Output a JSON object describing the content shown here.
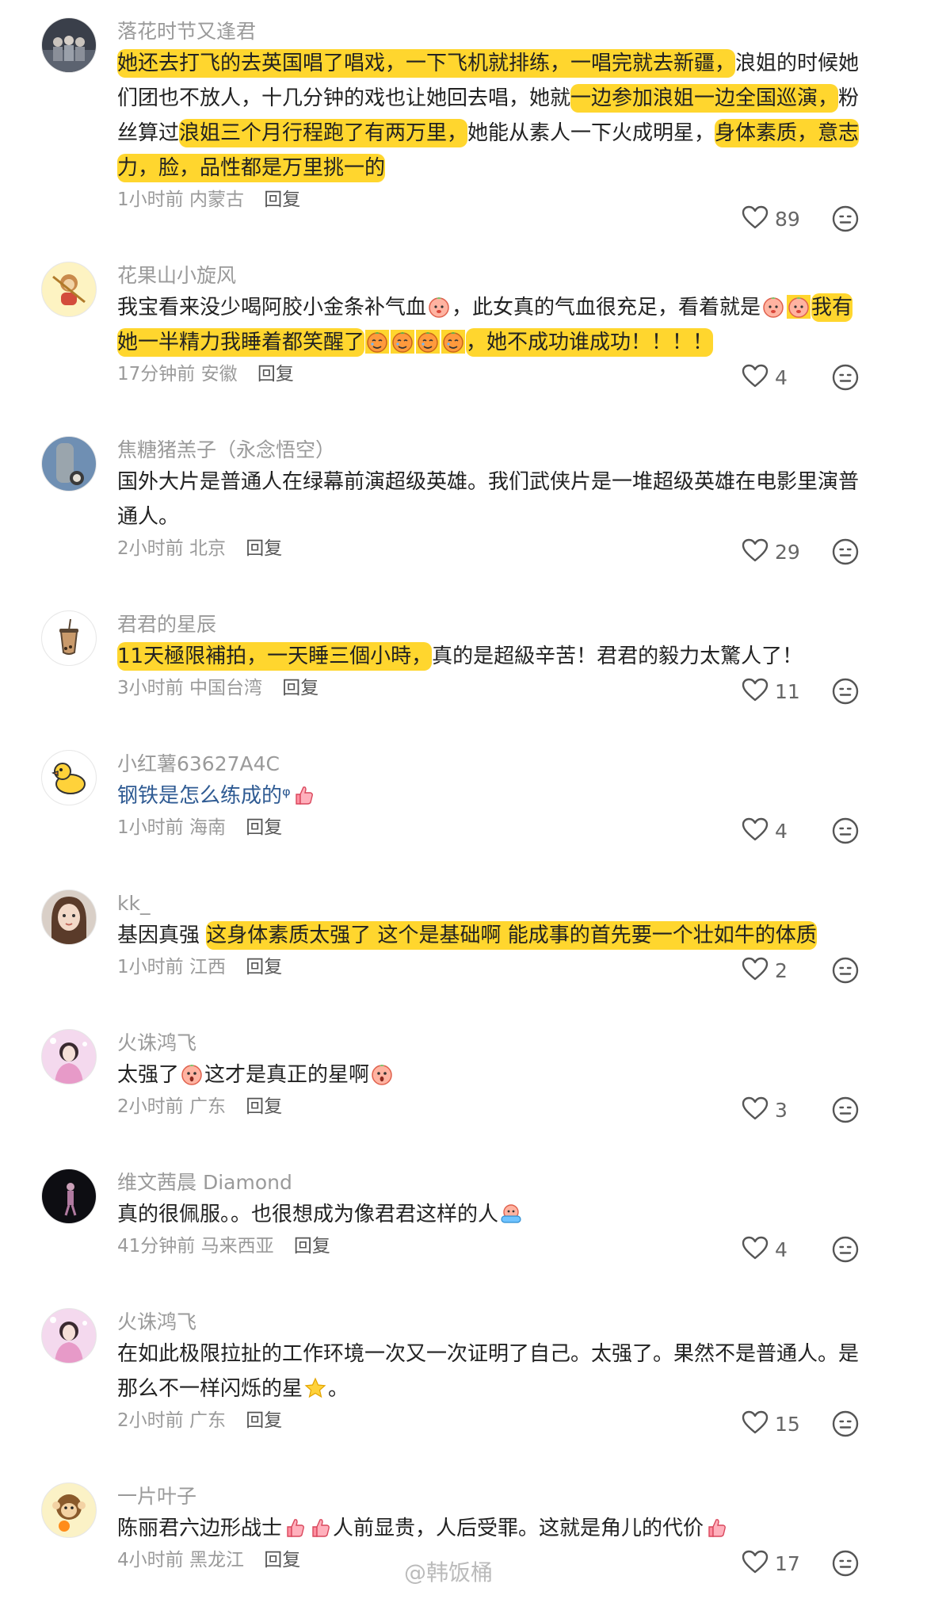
{
  "comments": [
    {
      "username": "落花时节又逢君",
      "text": [
        {
          "t": "她还去打飞的去英国唱了唱戏，一下飞机就排练，一唱完就去新疆，",
          "hl": true
        },
        {
          "t": "浪姐的时候她们团也不放人，十几分钟的戏也让她回去唱，她就"
        },
        {
          "t": "一边参加浪姐一边全国巡演，",
          "hl": true
        },
        {
          "t": "粉丝算过"
        },
        {
          "t": "浪姐三个月行程跑了有两万里，",
          "hl": true
        },
        {
          "t": "她能从素人一下火成明星，"
        },
        {
          "t": "身体素质，意志力，脸，品性都是万里挑一的",
          "hl": true
        }
      ],
      "time": "1小时前",
      "location": "内蒙古",
      "reply": "回复",
      "likes": "89"
    },
    {
      "username": "花果山小旋风",
      "text": [
        {
          "t": "我宝看来没少喝阿胶小金条补气血"
        },
        {
          "em": "peach-face"
        },
        {
          "t": "，此女真的气血很充足，看着就是"
        },
        {
          "em": "peach-face"
        },
        {
          "em": "peach-face",
          "hl": true
        },
        {
          "t": "我有她一半精力我睡着都笑醒了",
          "hl": true
        },
        {
          "em": "peach-cry",
          "hl": true
        },
        {
          "em": "peach-cry",
          "hl": true
        },
        {
          "em": "peach-cry",
          "hl": true
        },
        {
          "em": "peach-cry",
          "hl": true
        },
        {
          "t": "，她不成功谁成功！！！！",
          "hl": true
        }
      ],
      "time": "17分钟前",
      "location": "安徽",
      "reply": "回复",
      "likes": "4"
    },
    {
      "username": "焦糖猪羔子（永念悟空）",
      "text": [
        {
          "t": "国外大片是普通人在绿幕前演超级英雄。我们武侠片是一堆超级英雄在电影里演普通人。"
        }
      ],
      "time": "2小时前",
      "location": "北京",
      "reply": "回复",
      "likes": "29"
    },
    {
      "username": "君君的星辰",
      "text": [
        {
          "t": "11天極限補拍，一天睡三個小時，",
          "hl": true
        },
        {
          "t": "真的是超級辛苦！君君的毅力太驚人了！"
        }
      ],
      "time": "3小时前",
      "location": "中国台湾",
      "reply": "回复",
      "likes": "11"
    },
    {
      "username": "小红薯63627A4C",
      "text": [
        {
          "t": "钢铁是怎么练成的",
          "link": true
        },
        {
          "t": "ᵠ",
          "link": true
        },
        {
          "em": "thumb"
        }
      ],
      "time": "1小时前",
      "location": "海南",
      "reply": "回复",
      "likes": "4"
    },
    {
      "username": "kk_",
      "text": [
        {
          "t": "基因真强 "
        },
        {
          "t": "这身体素质太强了 这个是基础啊 能成事的首先要一个壮如牛的体质",
          "hl": true
        }
      ],
      "time": "1小时前",
      "location": "江西",
      "reply": "回复",
      "likes": "2"
    },
    {
      "username": "火诛鸿飞",
      "text": [
        {
          "t": "太强了"
        },
        {
          "em": "peach-wow"
        },
        {
          "t": "这才是真正的星啊"
        },
        {
          "em": "peach-wow"
        }
      ],
      "time": "2小时前",
      "location": "广东",
      "reply": "回复",
      "likes": "3"
    },
    {
      "username": "维文茜晨 Diamond",
      "text": [
        {
          "t": "真的很佩服。。也很想成为像君君这样的人"
        },
        {
          "em": "peach-bath"
        }
      ],
      "time": "41分钟前",
      "location": "马来西亚",
      "reply": "回复",
      "likes": "4"
    },
    {
      "username": "火诛鸿飞",
      "text": [
        {
          "t": "在如此极限拉扯的工作环境一次又一次证明了自己。太强了。果然不是普通人。是那么不一样闪烁的星"
        },
        {
          "em": "star"
        },
        {
          "t": "。"
        }
      ],
      "time": "2小时前",
      "location": "广东",
      "reply": "回复",
      "likes": "15"
    },
    {
      "username": "一片叶子",
      "text": [
        {
          "t": "陈丽君六边形战士"
        },
        {
          "em": "thumb"
        },
        {
          "em": "thumb"
        },
        {
          "t": "人前显贵，人后受罪。这就是角儿的代价"
        },
        {
          "em": "thumb"
        }
      ],
      "time": "4小时前",
      "location": "黑龙江",
      "reply": "回复",
      "likes": "17"
    }
  ],
  "watermark": "@韩饭桶",
  "colors": {
    "highlight": "#ffd62e",
    "link": "#2f5b93",
    "meta": "#9a9a9a"
  },
  "icons": {
    "like": "heart-outline-icon",
    "emoji": "smiley-outline-icon"
  }
}
